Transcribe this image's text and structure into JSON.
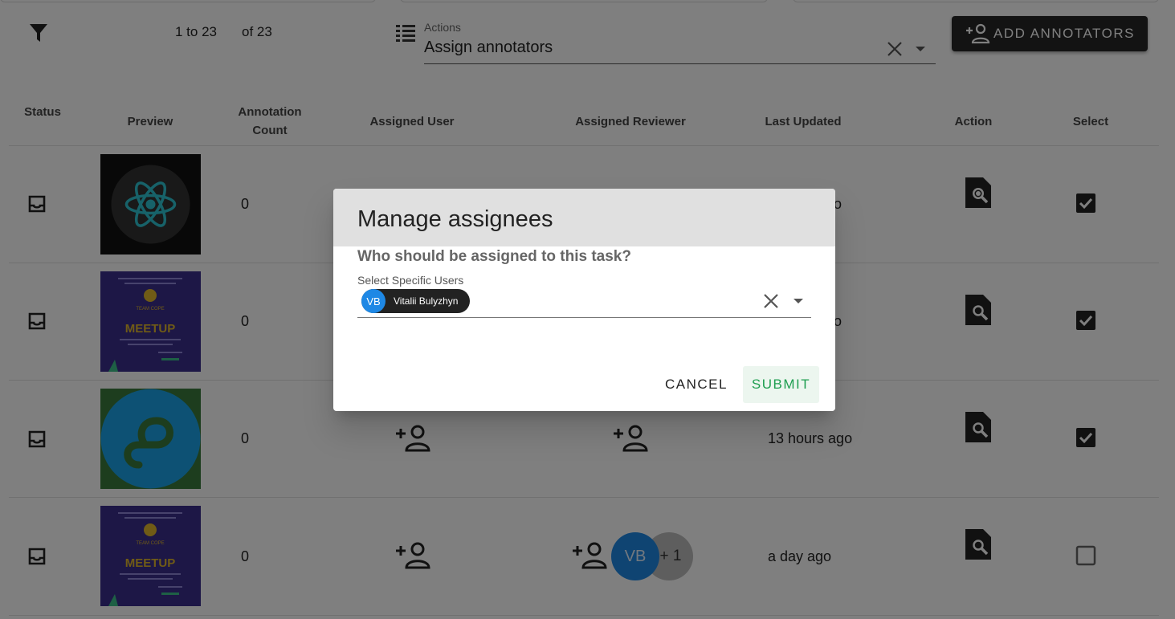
{
  "toolbar": {
    "pagination_range": "1 to 23",
    "pagination_total": "of 23",
    "actions_label": "Actions",
    "actions_value": "Assign annotators",
    "add_button_label": "ADD ANNOTATORS"
  },
  "table": {
    "headers": {
      "status": "Status",
      "preview": "Preview",
      "annotation_count_line1": "Annotation",
      "annotation_count_line2": "Count",
      "assigned_user": "Assigned User",
      "assigned_reviewer": "Assigned Reviewer",
      "last_updated": "Last Updated",
      "action": "Action",
      "select": "Select"
    },
    "rows": [
      {
        "annotation_count": "0",
        "last_updated": "ago",
        "selected": true,
        "preview": "react-logo"
      },
      {
        "annotation_count": "0",
        "last_updated": "ago",
        "selected": true,
        "preview": "meetup-poster"
      },
      {
        "annotation_count": "0",
        "last_updated": "13 hours ago",
        "selected": true,
        "preview": "blue-circle-logo"
      },
      {
        "annotation_count": "0",
        "last_updated": "a day ago",
        "selected": false,
        "preview": "meetup-poster",
        "reviewer_avatar": "VB",
        "reviewer_more": "+ 1"
      }
    ]
  },
  "poster": {
    "team_text": "TEAM COPE",
    "meetup_text": "MEETUP"
  },
  "dialog": {
    "title": "Manage assignees",
    "question": "Who should be assigned to this task?",
    "users_label": "Select Specific Users",
    "chip_avatar": "VB",
    "chip_name": "Vitalii Bulyzhyn",
    "cancel_label": "CANCEL",
    "submit_label": "SUBMIT"
  },
  "colors": {
    "accent_green": "#1e9e50",
    "avatar_blue": "#1e88e5",
    "react_cyan": "#2ec5d3",
    "poster_purple": "#3a2f8c",
    "poster_gold": "#e0b62c",
    "logo_blue": "#1aa3e8",
    "logo_green": "#3b7a3c"
  }
}
